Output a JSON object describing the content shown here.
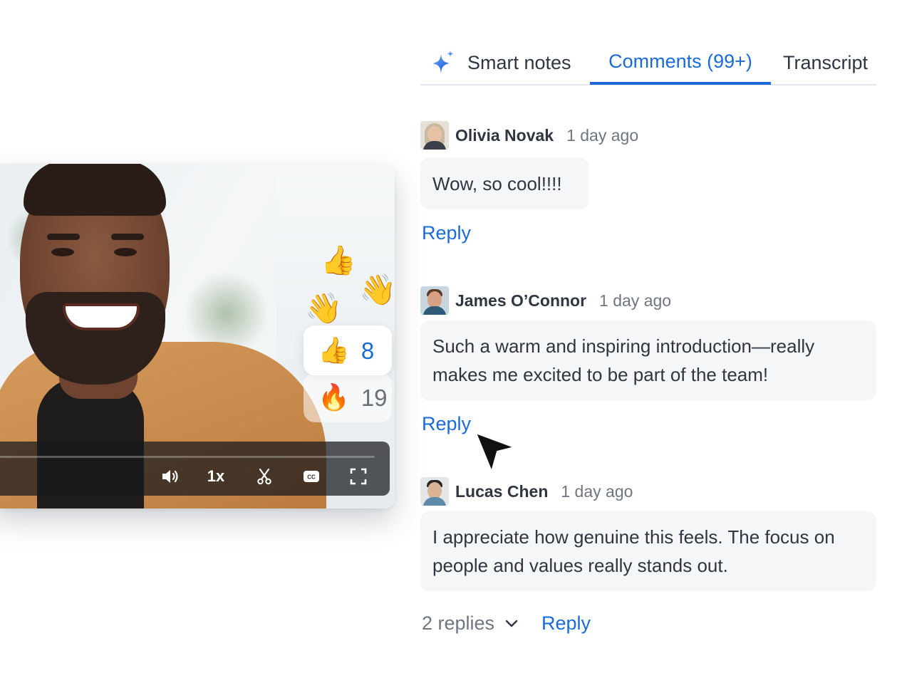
{
  "tabs": [
    {
      "label": "Smart notes",
      "active": false,
      "icon": "sparkle-icon"
    },
    {
      "label": "Comments (99+)",
      "active": true
    },
    {
      "label": "Transcript",
      "active": false
    }
  ],
  "comments": [
    {
      "author": "Olivia Novak",
      "time": "1 day ago",
      "text": "Wow, so cool!!!!",
      "reply_label": "Reply"
    },
    {
      "author": "James O’Connor",
      "time": "1 day ago",
      "text": "Such a warm and inspiring introduction—really makes me excited to be part of the team!",
      "reply_label": "Reply"
    },
    {
      "author": "Lucas Chen",
      "time": "1 day ago",
      "text": "I appreciate how genuine this feels. The focus on people and values really stands out.",
      "replies_label": "2 replies",
      "reply_label": "Reply"
    }
  ],
  "video": {
    "floating_reactions": [
      "👍",
      "👋",
      "👋"
    ],
    "reactions": [
      {
        "emoji": "👍",
        "count": "8",
        "active": true
      },
      {
        "emoji": "🔥",
        "count": "19",
        "active": false
      }
    ],
    "controls": {
      "speed": "1x",
      "volume_icon": "volume-icon",
      "clip_icon": "scissors-icon",
      "captions_icon": "captions-icon",
      "fullscreen_icon": "fullscreen-icon"
    }
  },
  "colors": {
    "accent": "#1a6bd6",
    "text": "#2f3640",
    "muted": "#6f7680",
    "bubble": "#f5f6f8"
  }
}
